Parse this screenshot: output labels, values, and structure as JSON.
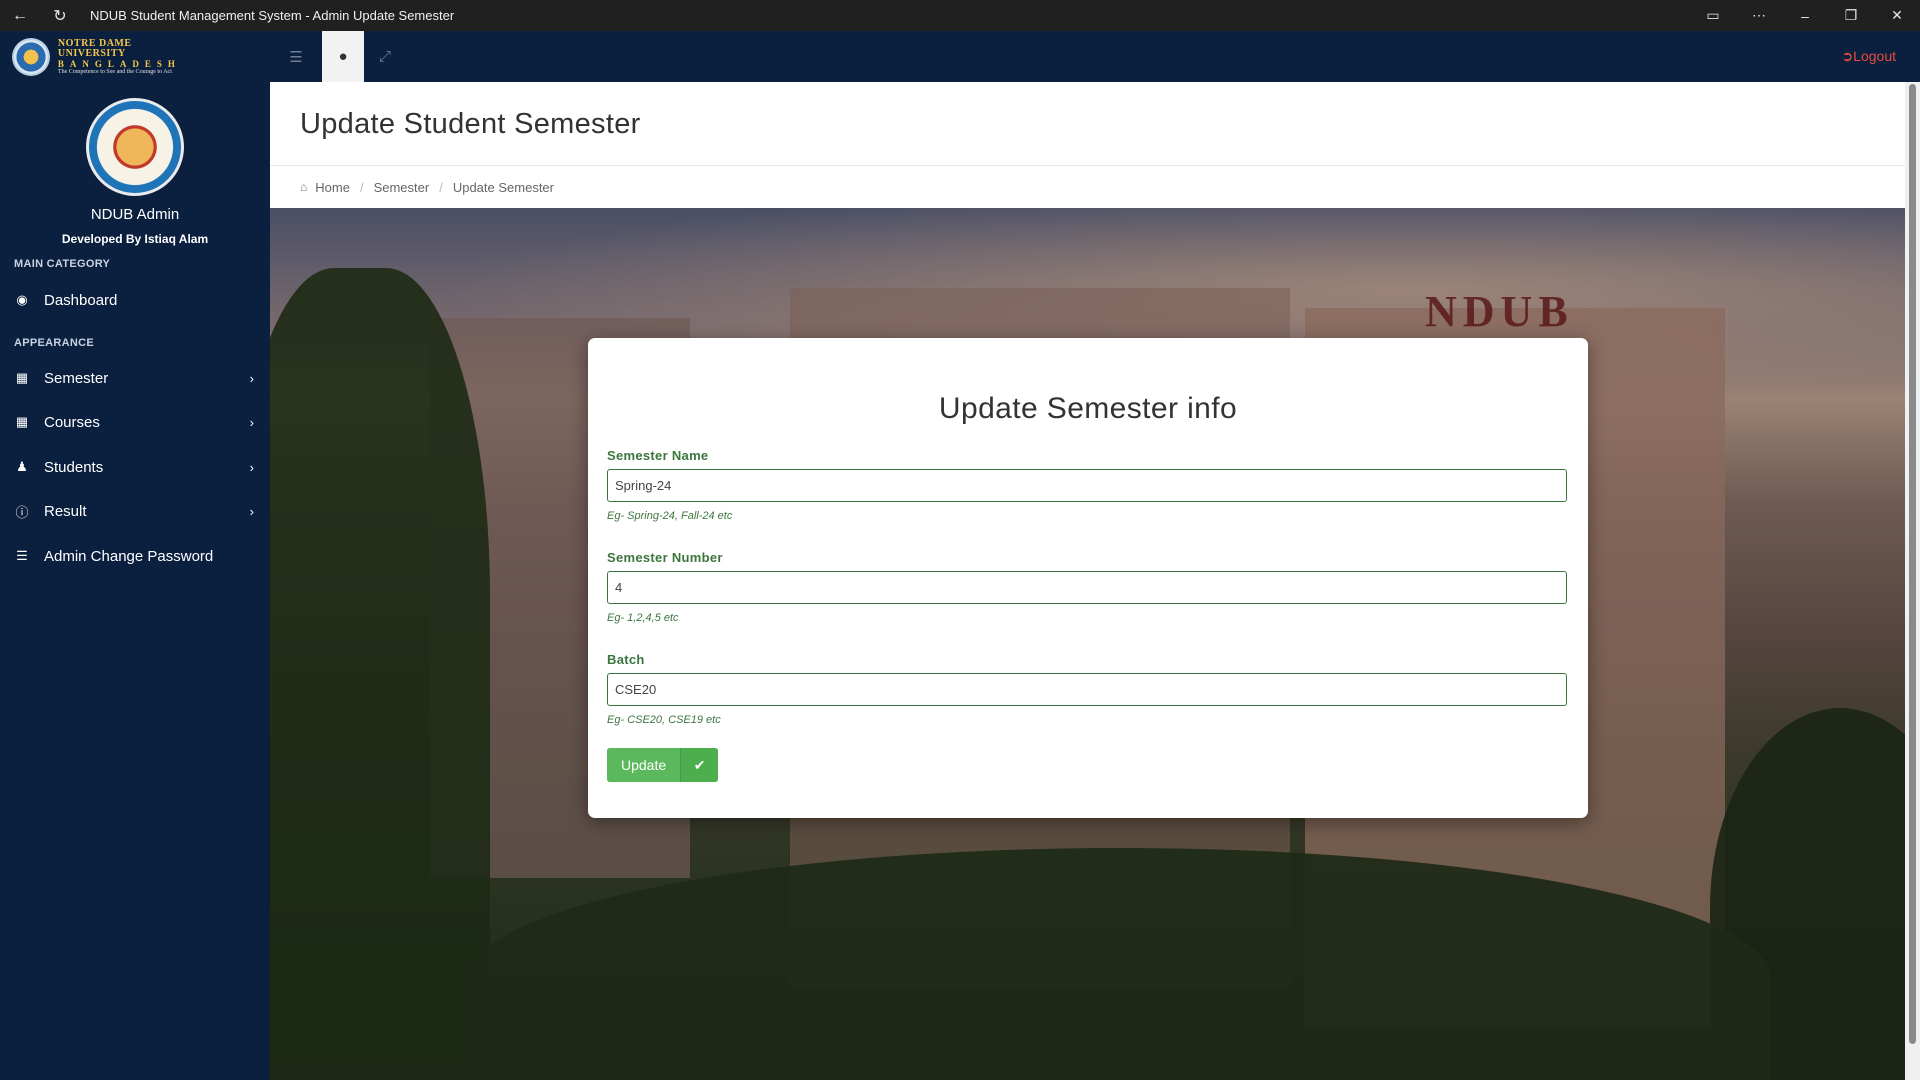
{
  "window": {
    "title": "NDUB Student Management System - Admin Update Semester"
  },
  "brand": {
    "line1": "NOTRE DAME UNIVERSITY",
    "line2": "BANGLADESH",
    "line3": "The Competence to See and the Courage to Act"
  },
  "topnav": {
    "logout_label": "Logout"
  },
  "sidebar": {
    "admin_name": "NDUB Admin",
    "developer": "Developed By Istiaq Alam",
    "main_category": "MAIN CATEGORY",
    "appearance": "APPEARANCE",
    "items": [
      {
        "label": "Dashboard",
        "icon": "dashboard-icon"
      },
      {
        "label": "Semester",
        "icon": "file-icon"
      },
      {
        "label": "Courses",
        "icon": "file-icon"
      },
      {
        "label": "Students",
        "icon": "users-icon"
      },
      {
        "label": "Result",
        "icon": "info-icon"
      },
      {
        "label": "Admin Change Password",
        "icon": "list-icon"
      }
    ]
  },
  "page": {
    "title": "Update Student Semester",
    "breadcrumb": [
      "Home",
      "Semester",
      "Update Semester"
    ]
  },
  "form": {
    "title": "Update Semester info",
    "fields": [
      {
        "label": "Semester Name",
        "value": "Spring-24",
        "help": "Eg- Spring-24, Fall-24 etc"
      },
      {
        "label": "Semester Number",
        "value": "4",
        "help": "Eg- 1,2,4,5 etc"
      },
      {
        "label": "Batch",
        "value": "CSE20",
        "help": "Eg- CSE20, CSE19 etc"
      }
    ],
    "submit_label": "Update"
  },
  "hero": {
    "sign_text": "NDUB"
  },
  "colors": {
    "nav_bg": "#0b1f3f",
    "success_green": "#3c763d",
    "button_green": "#5cb85c",
    "logout_red": "#e74c3c"
  }
}
